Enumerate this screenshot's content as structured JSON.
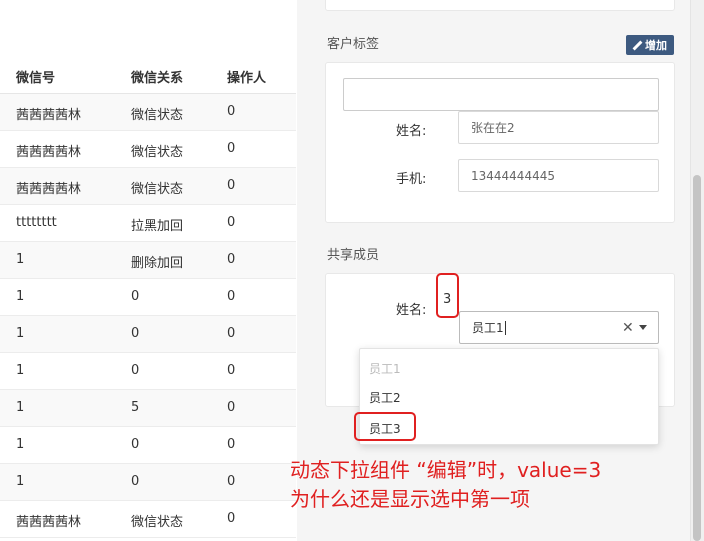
{
  "table": {
    "headers": [
      "微信号",
      "微信关系",
      "操作人"
    ],
    "rows": [
      [
        "茜茜茜茜林",
        "微信状态",
        "0"
      ],
      [
        "茜茜茜茜林",
        "微信状态",
        "0"
      ],
      [
        "茜茜茜茜林",
        "微信状态",
        "0"
      ],
      [
        "tttttttt",
        "拉黑加回",
        "0"
      ],
      [
        "1",
        "删除加回",
        "0"
      ],
      [
        "1",
        "0",
        "0"
      ],
      [
        "1",
        "0",
        "0"
      ],
      [
        "1",
        "0",
        "0"
      ],
      [
        "1",
        "5",
        "0"
      ],
      [
        "1",
        "0",
        "0"
      ],
      [
        "1",
        "0",
        "0"
      ],
      [
        "茜茜茜茜林",
        "微信状态",
        "0"
      ]
    ]
  },
  "customer_tags": {
    "title": "客户标签",
    "add_label": "增加",
    "tag_input_value": "",
    "name_label": "姓名:",
    "name_value": "张在在2",
    "phone_label": "手机:",
    "phone_value": "13444444445"
  },
  "shared_members": {
    "title": "共享成员",
    "name_label": "姓名:",
    "annotated_value": "3",
    "select_value": "员工1",
    "options": [
      "员工1",
      "员工2",
      "员工3"
    ],
    "clear_glyph": "✕"
  },
  "annotation": {
    "line1": "动态下拉组件 “编辑”时，value=3",
    "line2": "为什么还是显示选中第一项"
  },
  "colors": {
    "add_button": "#3d5a80",
    "annotation": "#e02020"
  }
}
